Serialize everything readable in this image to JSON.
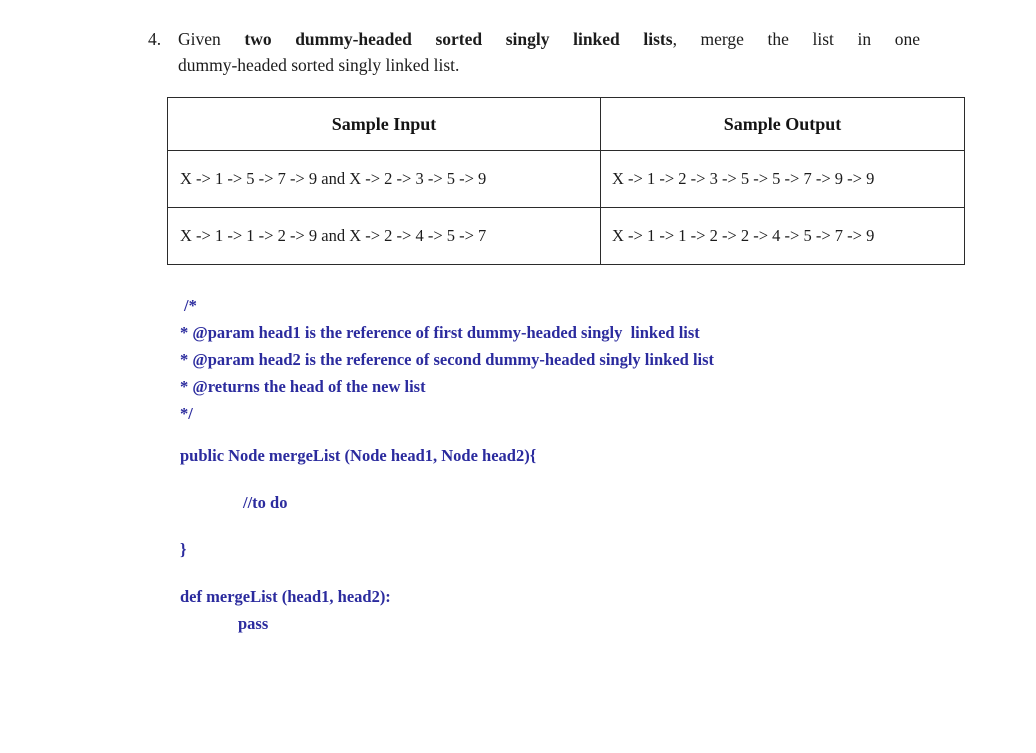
{
  "question": {
    "number": "4.",
    "line1_parts": [
      {
        "text": "Given ",
        "bold": false
      },
      {
        "text": "two dummy-headed sorted singly linked lists",
        "bold": true
      },
      {
        "text": ", merge the list in one",
        "bold": false
      }
    ],
    "intro": "Given",
    "emphasis": "two dummy-headed sorted singly linked lists",
    "rest": ", merge the list in one",
    "line2": "dummy-headed sorted singly linked list."
  },
  "table": {
    "headers": {
      "input": "Sample Input",
      "output": "Sample Output"
    },
    "rows": [
      {
        "input": "X -> 1 -> 5 -> 7 -> 9 and X -> 2 -> 3 -> 5 -> 9",
        "output": "X -> 1 -> 2 -> 3 -> 5 -> 5 -> 7 -> 9 -> 9"
      },
      {
        "input": "X -> 1 -> 1 -> 2 -> 9 and X -> 2 -> 4 -> 5 -> 7",
        "output": "X -> 1 -> 1 -> 2 -> 2 -> 4 -> 5 -> 7 -> 9"
      }
    ]
  },
  "code": {
    "color": "#2b2b9e",
    "comment_open": "/*",
    "comment_param1": "* @param head1 is the reference of first dummy-headed singly  linked list",
    "comment_param2": "* @param head2 is the reference of second dummy-headed singly linked list",
    "comment_returns": "* @returns the head of the new list",
    "comment_close": "*/",
    "java_signature": "public Node mergeList (Node head1, Node head2){",
    "java_todo": "//to do",
    "java_close": "}",
    "python_def": "def mergeList (head1, head2):",
    "python_pass": "pass"
  }
}
